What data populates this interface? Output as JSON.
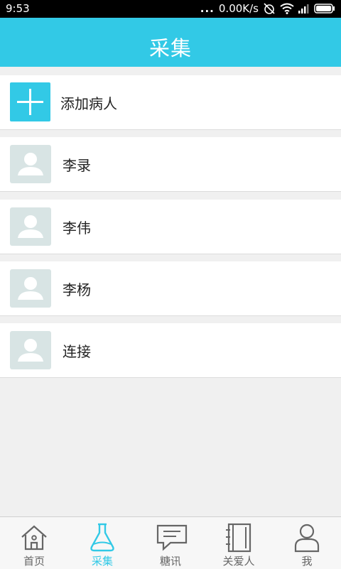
{
  "status_bar": {
    "time": "9:53",
    "network_speed": "0.00K/s",
    "dots": "..."
  },
  "header": {
    "title": "采集"
  },
  "add_patient": {
    "label": "添加病人"
  },
  "patients": [
    {
      "name": "李录"
    },
    {
      "name": "李伟"
    },
    {
      "name": "李杨"
    },
    {
      "name": "连接"
    }
  ],
  "tabs": [
    {
      "label": "首页",
      "icon": "home-icon",
      "active": false
    },
    {
      "label": "采集",
      "icon": "flask-icon",
      "active": true
    },
    {
      "label": "糖讯",
      "icon": "message-icon",
      "active": false
    },
    {
      "label": "关爱人",
      "icon": "contacts-book-icon",
      "active": false
    },
    {
      "label": "我",
      "icon": "user-icon",
      "active": false
    }
  ],
  "colors": {
    "accent": "#32c9e6",
    "avatar_bg": "#d8e4e4",
    "background": "#f0f0f0"
  }
}
